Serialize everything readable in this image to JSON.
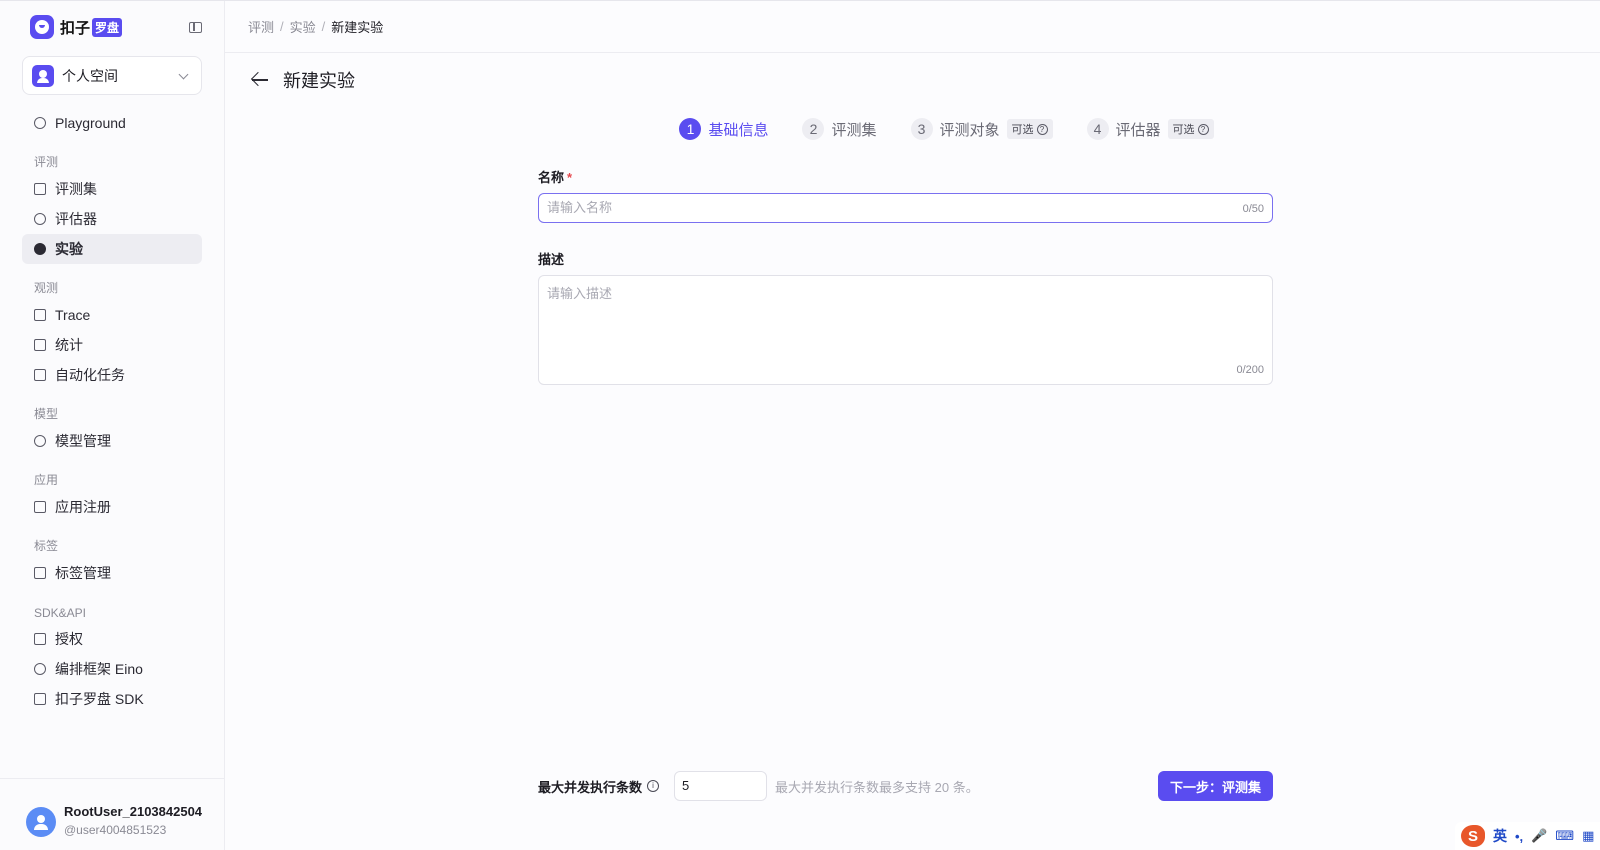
{
  "app": {
    "logo_text": "扣子",
    "logo_badge": "罗盘"
  },
  "space": {
    "label": "个人空间"
  },
  "nav": {
    "playground": "Playground",
    "group_eval": "评测",
    "evalset": "评测集",
    "evaluator": "评估器",
    "experiment": "实验",
    "group_observe": "观测",
    "trace": "Trace",
    "stats": "统计",
    "automation": "自动化任务",
    "group_model": "模型",
    "model_mgmt": "模型管理",
    "group_app": "应用",
    "app_register": "应用注册",
    "group_tag": "标签",
    "tag_mgmt": "标签管理",
    "group_sdk": "SDK&API",
    "auth": "授权",
    "eino": "编排框架 Eino",
    "sdk": "扣子罗盘 SDK"
  },
  "user": {
    "name": "RootUser_2103842504",
    "handle": "@user4004851523"
  },
  "breadcrumb": {
    "c1": "评测",
    "c2": "实验",
    "c3": "新建实验",
    "sep": "/"
  },
  "page": {
    "title": "新建实验"
  },
  "steps": [
    {
      "num": "1",
      "label": "基础信息",
      "tag": ""
    },
    {
      "num": "2",
      "label": "评测集",
      "tag": ""
    },
    {
      "num": "3",
      "label": "评测对象",
      "tag": "可选"
    },
    {
      "num": "4",
      "label": "评估器",
      "tag": "可选"
    }
  ],
  "form": {
    "name_label": "名称",
    "name_required": "*",
    "name_placeholder": "请输入名称",
    "name_value": "",
    "name_counter": "0/50",
    "desc_label": "描述",
    "desc_placeholder": "请输入描述",
    "desc_counter": "0/200"
  },
  "footer": {
    "concurrency_label": "最大并发执行条数",
    "concurrency_value": "5",
    "concurrency_hint": "最大并发执行条数最多支持 20 条。",
    "next_button": "下一步：评测集"
  },
  "ime": {
    "logo": "S",
    "lang": "英",
    "punct": "•,",
    "mic": "🎤",
    "kbd": "⌨",
    "grid": "▦"
  },
  "colors": {
    "accent": "#5a4cf0",
    "required": "#e5484d"
  }
}
